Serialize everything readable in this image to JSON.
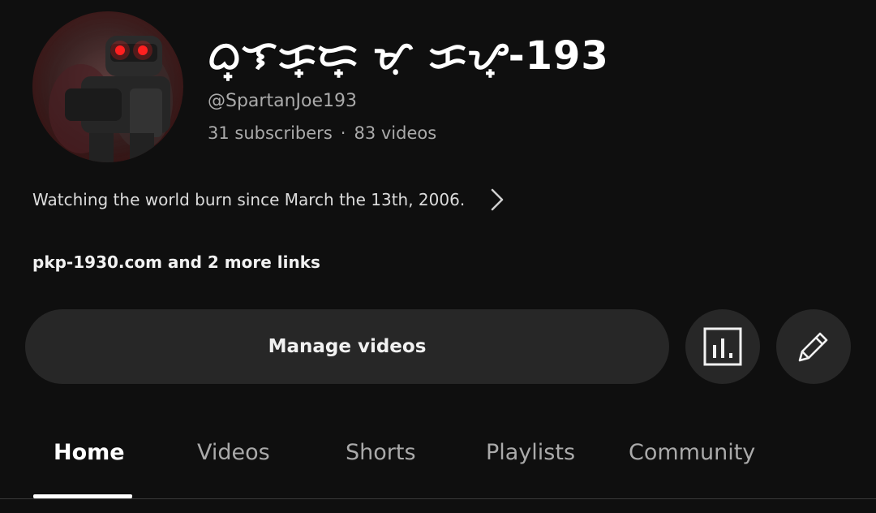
{
  "channel": {
    "name": "ᜊ᜔ᜎᜃ᜔ᜇ᜔ ᜋᜓ ᜃᜌ᜔-193",
    "handle": "@SpartanJoe193",
    "subscribers": "31 subscribers",
    "separator": "·",
    "videos": "83 videos",
    "description": "Watching the world burn since March the 13th, 2006.",
    "links": "pkp-1930.com and 2 more links",
    "avatar_icon": "robot-avatar"
  },
  "actions": {
    "manage_label": "Manage videos",
    "analytics_icon": "analytics-icon",
    "edit_icon": "pencil-icon"
  },
  "tabs": [
    {
      "label": "Home",
      "active": true
    },
    {
      "label": "Videos",
      "active": false
    },
    {
      "label": "Shorts",
      "active": false
    },
    {
      "label": "Playlists",
      "active": false
    },
    {
      "label": "Community",
      "active": false
    }
  ],
  "colors": {
    "background": "#0f0f0f",
    "button": "#272727",
    "text_primary": "#f1f1f1",
    "text_secondary": "#aaaaaa",
    "avatar_eyes": "#ff2020"
  }
}
